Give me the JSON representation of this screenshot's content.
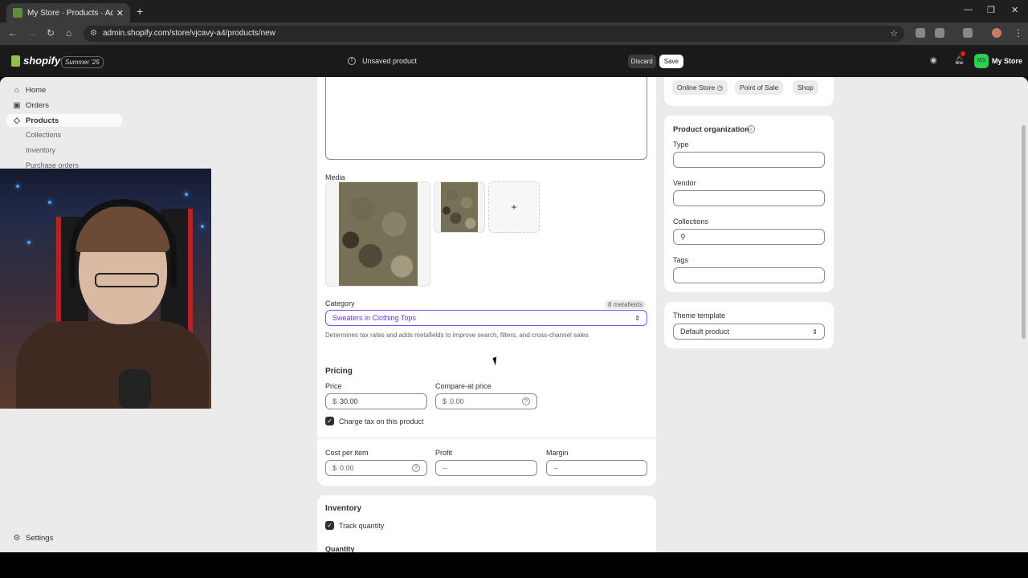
{
  "browser": {
    "tab_title": "My Store · Products · Add prod",
    "url": "admin.shopify.com/store/vjcavy-a4/products/new"
  },
  "topbar": {
    "logo": "shopify",
    "edition": "Summer '25",
    "unsaved": "Unsaved product",
    "discard": "Discard",
    "save": "Save",
    "avatar": "MS",
    "store": "My Store"
  },
  "sidebar": {
    "items": [
      {
        "label": "Home"
      },
      {
        "label": "Orders"
      },
      {
        "label": "Products"
      }
    ],
    "subitems": [
      {
        "label": "Collections"
      },
      {
        "label": "Inventory"
      },
      {
        "label": "Purchase orders"
      }
    ],
    "settings": "Settings"
  },
  "product": {
    "media_label": "Media",
    "add_media": "+",
    "category_label": "Category",
    "metafields": "8 metafields",
    "category_value": "Sweaters in Clothing Tops",
    "category_help": "Determines tax rates and adds metafields to improve search, filters, and cross-channel sales"
  },
  "pricing": {
    "title": "Pricing",
    "price_label": "Price",
    "price_currency": "$",
    "price_value": "30.00",
    "compare_label": "Compare-at price",
    "compare_currency": "$",
    "compare_placeholder": "0.00",
    "charge_tax": "Charge tax on this product",
    "cost_label": "Cost per item",
    "cost_currency": "$",
    "cost_placeholder": "0.00",
    "profit_label": "Profit",
    "profit_value": "--",
    "margin_label": "Margin",
    "margin_value": "--"
  },
  "inventory": {
    "title": "Inventory",
    "track": "Track quantity",
    "quantity_label": "Quantity"
  },
  "channels": [
    "Online Store",
    "Point of Sale",
    "Shop"
  ],
  "organization": {
    "title": "Product organization",
    "type_label": "Type",
    "vendor_label": "Vendor",
    "collections_label": "Collections",
    "tags_label": "Tags"
  },
  "theme": {
    "label": "Theme template",
    "value": "Default product"
  },
  "colors": {
    "accent_purple": "#8051ff",
    "shopify_green": "#95bf47"
  }
}
